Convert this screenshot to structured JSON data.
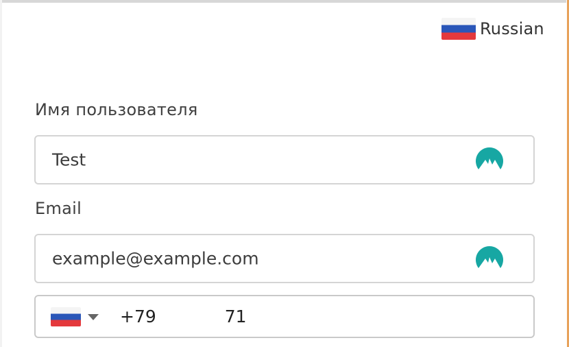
{
  "language": {
    "label": "Russian",
    "flag_icon": "flag-ru-icon"
  },
  "form": {
    "username": {
      "label": "Имя пользователя",
      "value": "Test",
      "action_icon": "nordpass-icon"
    },
    "email": {
      "label": "Email",
      "value": "example@example.com",
      "action_icon": "nordpass-icon"
    },
    "phone": {
      "country_flag_icon": "flag-ru-icon",
      "dropdown_icon": "chevron-down-icon",
      "prefix": "+79",
      "suffix": "71"
    }
  },
  "colors": {
    "frame": "#d7d7d7",
    "accent_edge": "#e8a25b",
    "label_text": "#3f3f3f",
    "input_border": "#d4d4d4",
    "nordpass_teal": "#17a7a3"
  }
}
